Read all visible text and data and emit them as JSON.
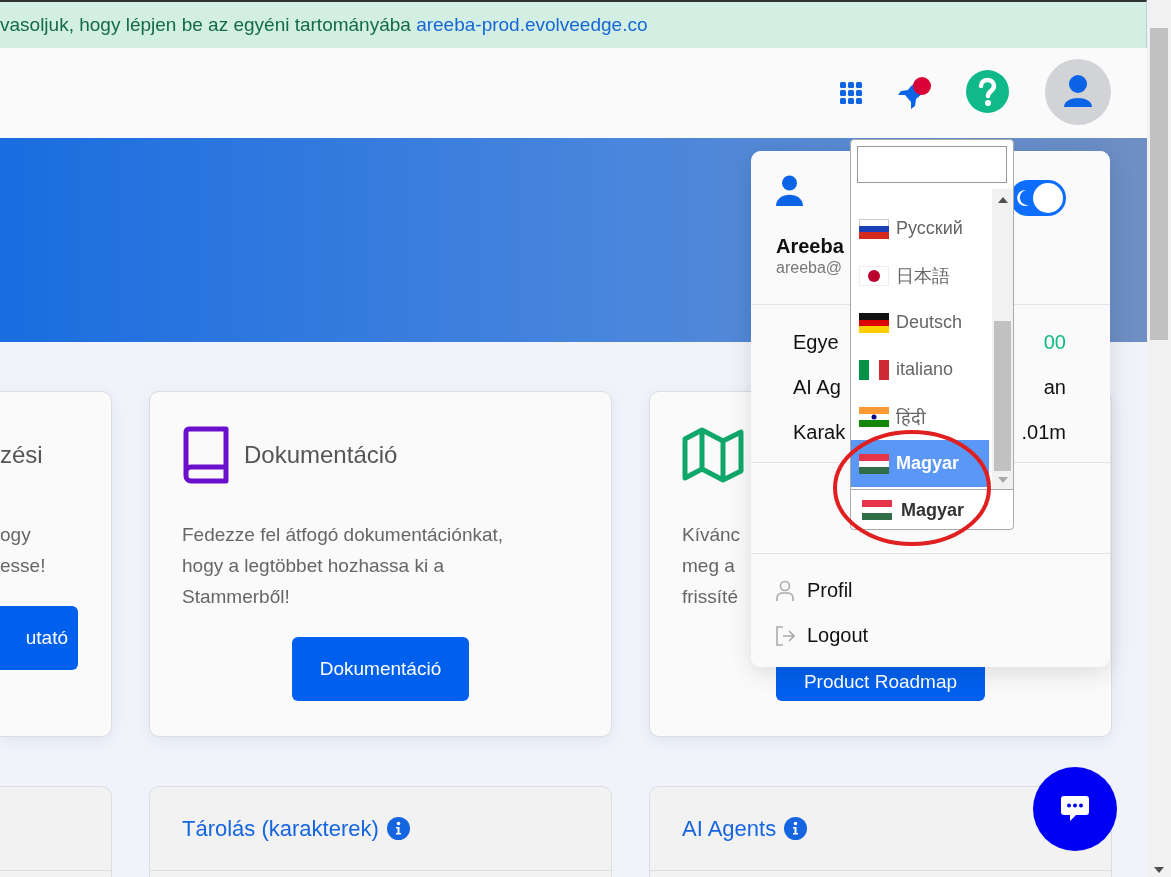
{
  "notice": {
    "text": "vasoljuk, hogy lépjen be az egyéni tartományába",
    "link": "areeba-prod.evolveedge.co"
  },
  "cards": [
    {
      "kind": "clipped",
      "title": "zési",
      "lines": [
        "ogy",
        "esse!"
      ],
      "button": "utató"
    },
    {
      "kind": "book",
      "title": "Dokumentáció",
      "description": "Fedezze fel átfogó dokumentációnkat, hogy a legtöbbet hozhassa ki a Stammerből!",
      "button": "Dokumentáció"
    },
    {
      "kind": "map",
      "lines": [
        "Kívánc",
        "meg a",
        "frissíté"
      ],
      "button": "Product Roadmap"
    }
  ],
  "bottom_cards": [
    {
      "kind": "clipped"
    },
    {
      "kind": "full",
      "title": "Tárolás (karakterek)",
      "info": true
    },
    {
      "kind": "full",
      "title": "AI Agents",
      "info": true
    }
  ],
  "user_menu": {
    "name": "Areeba",
    "email": "areeba@",
    "dark_mode": true,
    "stats": [
      {
        "label": "Egye",
        "value": "00",
        "color": "#10b981"
      },
      {
        "label": "AI Ag",
        "value": "an",
        "color": "#111111"
      },
      {
        "label": "Karak",
        "value": ".01m",
        "color": "#111111"
      }
    ],
    "links": [
      {
        "label": "Profil",
        "kind": "profile"
      },
      {
        "label": "Logout",
        "kind": "logout"
      }
    ]
  },
  "language_select": {
    "options": [
      {
        "label": "Русский",
        "kind": "ru",
        "selected": false
      },
      {
        "label": "日本語",
        "kind": "jp",
        "selected": false
      },
      {
        "label": "Deutsch",
        "kind": "de",
        "selected": false
      },
      {
        "label": "italiano",
        "kind": "it",
        "selected": false
      },
      {
        "label": "हिंदी",
        "kind": "in",
        "selected": false
      },
      {
        "label": "Magyar",
        "kind": "hu",
        "selected": true
      }
    ],
    "current": {
      "label": "Magyar",
      "kind": "hu"
    }
  }
}
